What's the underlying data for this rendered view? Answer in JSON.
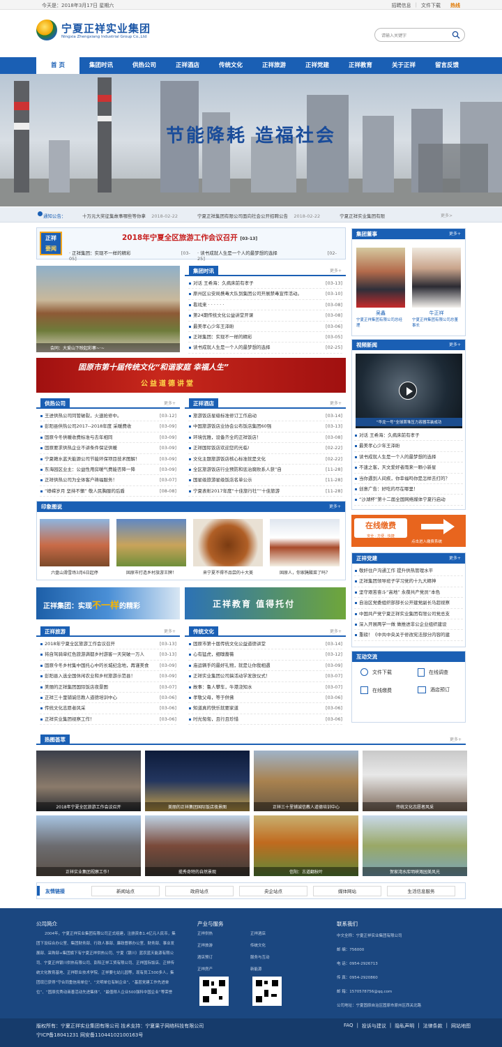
{
  "topbar": {
    "date": "今天是：2018年3月17日 星期六",
    "links": [
      "招聘信息",
      "文件下载"
    ],
    "hot": "热线"
  },
  "header": {
    "logo_cn": "宁夏正祥实业集团",
    "logo_en": "Ningxia Zhengxiang Industrial Group Co.,Ltd",
    "search_placeholder": "请输入关键字"
  },
  "nav": [
    "首 页",
    "集团时讯",
    "供热公司",
    "正祥酒店",
    "传统文化",
    "正祥旅游",
    "正祥党建",
    "正祥教育",
    "关于正祥",
    "留言反馈"
  ],
  "banner": {
    "slogan": "节能降耗  造福社会"
  },
  "notice": {
    "label": "通知公告：",
    "items": [
      {
        "t": "十万元大奖征集故事哪些等你拿",
        "d": "2018-02-22"
      },
      {
        "t": "宁夏正祥集团有限公司面向社会公开招聘公告",
        "d": "2018-02-22"
      },
      {
        "t": "宁夏正祥实业集团有限",
        "d": ""
      }
    ],
    "more": "更多>"
  },
  "headline": {
    "badge1": "正祥",
    "badge2": "要闻",
    "title": "2018年宁夏全区旅游工作会议召开",
    "title_date": "[03-13]",
    "sub": [
      {
        "t": "正祥集团：实现不一样的精彩",
        "d": "[03-05]"
      },
      {
        "t": "读书成就人生是一个人的最梦想的选择",
        "d": "[02-25]"
      }
    ]
  },
  "slider": {
    "caption": "会同：大爱山下映起彩寨~·~"
  },
  "news": {
    "title": "集团时讯",
    "more": "更多+",
    "items": [
      {
        "t": "对话 王希海：久病床前有孝子",
        "d": "[03-13]"
      },
      {
        "t": "原州区公安局携毒大队到集团公司开展禁毒宣传活动。",
        "d": "[03-10]"
      },
      {
        "t": "看戏来 · · · · · ·",
        "d": "[03-08]"
      },
      {
        "t": "第24期传统文化公益讲堂开课",
        "d": "[03-08]"
      },
      {
        "t": "最美孝心少年王泽盼",
        "d": "[03-06]"
      },
      {
        "t": "正祥集团：实现不一样的精彩",
        "d": "[03-05]"
      },
      {
        "t": "读书成就人生是一个人的最梦想的选择",
        "d": "[02-25]"
      }
    ]
  },
  "ad_banner": {
    "line1": "固原市第十届传统文化“和谐家庭 幸福人生”",
    "line2": "公益道德讲堂"
  },
  "heating": {
    "title": "供热公司",
    "more": "更多+",
    "items": [
      {
        "t": "王进供热公司同管破裂，火速抢修中。",
        "d": "[03-12]"
      },
      {
        "t": "彭阳县供热公司2017--2018年度 采暖费收",
        "d": "[03-09]"
      },
      {
        "t": "固原今冬供暖收费标准与去年相同",
        "d": "[03-09]"
      },
      {
        "t": "固原要求供热企业不讲条件保证供暖",
        "d": "[03-09]"
      },
      {
        "t": "宁夏赣水蓝天能源公司节能环保项目技术图解！",
        "d": "[03-09]"
      },
      {
        "t": "东海园区业主：公益性用房暖气费能否降一降",
        "d": "[03-09]"
      },
      {
        "t": "正祥供热公司为全体客户祷福服务！",
        "d": "[03-07]"
      },
      {
        "t": "“峥嵘岁月 坚持不懈” 敬人民胸服的后盾",
        "d": "[08-08]"
      }
    ]
  },
  "hotel": {
    "title": "正祥酒店",
    "more": "更多+",
    "items": [
      {
        "t": "旅游饭店星级标准修订工作启动",
        "d": "[03-14]"
      },
      {
        "t": "中国旅游饭店业协会公布饭店集团60强",
        "d": "[03-13]"
      },
      {
        "t": "环境优雅，设备齐全的正祥饭店！",
        "d": "[03-08]"
      },
      {
        "t": "正祥国际饭店欢迎您的光临!",
        "d": "[02-22]"
      },
      {
        "t": "文化主题旅游饭店核心标准就是文化",
        "d": "[02-22]"
      },
      {
        "t": "全区旅游饭店行业预防和惩治腐败系人获”自",
        "d": "[11-28]"
      },
      {
        "t": "国星级旅游星级饭店名单公示",
        "d": "[11-28]"
      },
      {
        "t": "宁夏表彰2017年度“十佳旅行社”“十佳旅游",
        "d": "[11-28]"
      }
    ]
  },
  "impression": {
    "title": "印象图说",
    "more": "更多+",
    "items": [
      "六盘山滑雪场3月6日起停",
      "固原市打造乡村旅游王牌！",
      "来宁夏不得不品尝的十大美",
      "固原人，你家腌酸菜了吗？"
    ]
  },
  "promo": {
    "left_a": "正祥集团：实现",
    "left_b": "不一样",
    "left_c": "的精彩",
    "right": "正祥教育 值得托付"
  },
  "travel": {
    "title": "正祥旅游",
    "more": "更多+",
    "items": [
      {
        "t": "2018年宁夏全区旅游工作会议召开",
        "d": "[03-13]"
      },
      {
        "t": "将自驾骑单红色旅游满都乡村游客一天突破一万人",
        "d": "[03-13]"
      },
      {
        "t": "固原今冬乡村集中国托心中的长城纪念地，再谨美食",
        "d": "[03-09]"
      },
      {
        "t": "彭阳县入选全国休闲农业和乡村旅游示范县！",
        "d": "[03-09]"
      },
      {
        "t": "美丽的正祥集团国际饭店夜景图",
        "d": "[03-07]"
      },
      {
        "t": "正祥三十里铺诚信教人道德培训中心",
        "d": "[03-06]"
      },
      {
        "t": "传统文化志愿者风采",
        "d": "[03-06]"
      },
      {
        "t": "正祥实业集团视察工作！",
        "d": "[03-06]"
      }
    ]
  },
  "culture": {
    "title": "传统文化",
    "more": "更多+",
    "items": [
      {
        "t": "固原市第十届传统文化公益道德讲堂",
        "d": "[03-14]"
      },
      {
        "t": "心有猛虎，细嗅蔷薇",
        "d": "[03-12]"
      },
      {
        "t": "庙运辆手的最好礼物，就是让你我相遇",
        "d": "[03-09]"
      },
      {
        "t": "正祥实业集团公司搞活动学发放仪式！",
        "d": "[03-07]"
      },
      {
        "t": "故事：鲁人攀车，牛港浇知水",
        "d": "[03-07]"
      },
      {
        "t": "孝敬父母，等于供佛",
        "d": "[03-06]"
      },
      {
        "t": "知道真的快乐就要家道",
        "d": "[03-06]"
      },
      {
        "t": "时光匆匆，且行且珍惜",
        "d": "[03-06]"
      }
    ]
  },
  "chairman": {
    "title": "集团董事",
    "more": "更多+",
    "people": [
      {
        "name": "吴鑫",
        "desc": "宁夏正祥集团有限公司总经理"
      },
      {
        "name": "牛正祥",
        "desc": "宁夏正祥集团有限公司总董事长"
      }
    ]
  },
  "video": {
    "title": "视频新闻",
    "more": "更多+",
    "caption": "“华龙一号”全球首堆压力容器吊装成功",
    "items": [
      "对话 王希海：久病床前有孝子",
      "最美孝心少年王泽盼",
      "读书成就人生是一个人的最梦想的选择",
      "不速之客，天文爱好者雨来一颗小新星",
      "当你遇到人间疾，你幸福吗你是怎样去打的？",
      "创意广告：好吃的尽在哪里！",
      "“沙湖杯”第十二届全国网络媒体宁夏行启动"
    ]
  },
  "payment": {
    "label": "在线缴费",
    "sub": "安全 · 方便 · 快捷",
    "hint": "点击进入缴费系统"
  },
  "party": {
    "title": "正祥党建",
    "more": "更多+",
    "items": [
      "敬奸住户沟通工作 提升供热管理水平",
      "正祥集团领导班子学习党的十九大精神",
      "坚守艰苦奋斗“高地” 永葆共产党员“本色",
      "自治区党委组织部部长公开建党副长马超视察",
      "中国共产党宁夏正祥实业集团有限公司党总支",
      "深入开展两学一做 做推进非公企业组织建设",
      "重磅！《中共中央关于修改宪法部分内容的建"
    ]
  },
  "interact": {
    "title": "互动交流",
    "items": [
      "文件下载",
      "在线调查",
      "在线缴费",
      "酒店预订"
    ]
  },
  "hot": {
    "title": "热图荟萃",
    "more": "更多+",
    "items": [
      "2018年宁夏全区旅游工作会议召开",
      "美丽的正祥集团国际饭店夜景图",
      "正祥三十里铺诚信教人道德培训中心",
      "传统文化志愿者风采",
      "正祥实业集团视察工作！",
      "揽秀奇特的自然景观",
      "信阳：古道翻秋叶",
      "贺家湾水库明峡溉园美风光"
    ]
  },
  "links": {
    "title": "友情链接",
    "items": [
      "新闻站点",
      "政府站点",
      "央企站点",
      "媒体网站",
      "生活信息服务"
    ]
  },
  "footer": {
    "about_title": "公司简介",
    "about_text": "2004年，宁夏正祥实业集团有限公司正式组建，注册资本1.4亿元人民币，集团下设综合办公室、集团财务部、行政人事部、廉政督察办公室、财务部、事业发展部、采购部+集团旗下有宁夏正祥供热公司、宁夏（银川）蓝农蓝天能源有限公司、宁夏正祥银川供热有限公司、彭阳正祥工贸有限公司、正祥国际饭店、正祥传统文化教育基地、正祥职业技术学院、正祥要七幼儿园等，现有员工500多人，集团现已获得“守合同重信用单位”、“文明单位有制企业”、“基层党建工作先进单位”、“固原优秀动商善活动先进集体”、“最值得人企业500强科中国企业”等荣誉",
    "service_title": "产业与服务",
    "services": [
      "正祥供热",
      "正祥酒店",
      "正祥旅游",
      "传统文化",
      "酒店预订",
      "服务与互动",
      "正祥房产",
      "新能源"
    ],
    "contact_title": "联系我们",
    "contact": [
      "中文全称：宁夏正祥实业集团有限公司",
      "邮  编：756000",
      "电  话：0954-2926713",
      "传  真：0954-2920860",
      "邮  箱：1570578756@qq.com",
      "公司地址：宁夏固原自治区固原市原州区西关北路"
    ],
    "copyright": "版权所有：宁夏正祥实业集团有限公司 技术支持：宁夏果子网络科技有限公司",
    "icp": "宁ICP备18041231  网安备11044102100163号",
    "bottom_links": [
      "FAQ",
      "投诉与建议",
      "隐私声明",
      "法律条款",
      "网站地图"
    ]
  },
  "colors": {
    "brand": "#1a5fb4",
    "accent": "#e05a1a",
    "footer": "#1b4780"
  }
}
